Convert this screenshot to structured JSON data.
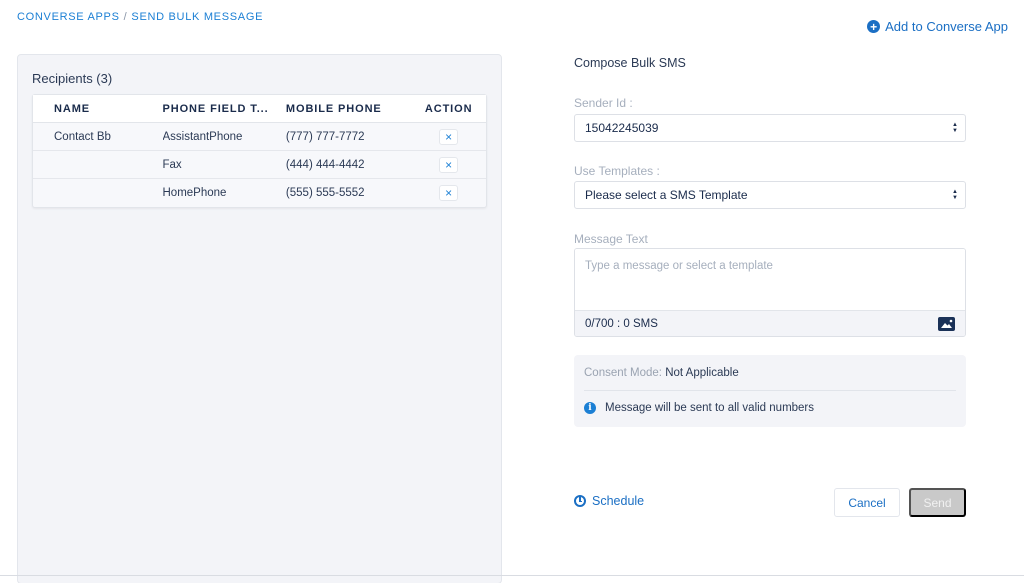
{
  "breadcrumb": {
    "items": [
      "Converse Apps",
      "Send Bulk Message"
    ],
    "separator": "/"
  },
  "header": {
    "add_app_label": "Add to Converse App",
    "add_app_icon": "plus-circle-icon"
  },
  "recipients": {
    "title": "Recipients (3)",
    "columns": [
      "NAME",
      "PHONE FIELD T...",
      "MOBILE PHONE",
      "ACTION"
    ],
    "rows": [
      {
        "name": "Contact Bb",
        "phone_field_type": "AssistantPhone",
        "mobile_phone": "(777) 777-7772",
        "action_icon": "×"
      },
      {
        "name": "",
        "phone_field_type": "Fax",
        "mobile_phone": "(444) 444-4442",
        "action_icon": "×"
      },
      {
        "name": "",
        "phone_field_type": "HomePhone",
        "mobile_phone": "(555) 555-5552",
        "action_icon": "×"
      }
    ]
  },
  "compose": {
    "title": "Compose Bulk SMS",
    "sender_id": {
      "label": "Sender Id :",
      "value": "15042245039"
    },
    "templates": {
      "label": "Use Templates :",
      "value": "Please select a SMS Template"
    },
    "message": {
      "label": "Message Text",
      "value": "",
      "placeholder": "Type a message or select a template",
      "counter": "0/700 : 0 SMS"
    },
    "consent": {
      "key": "Consent Mode:",
      "value": "Not Applicable",
      "info": "Message will be sent to all valid numbers"
    },
    "schedule_label": "Schedule",
    "cancel_label": "Cancel",
    "send_label": "Send"
  },
  "colors": {
    "accent": "#1b7fd4",
    "text_dark": "#16325c",
    "panel_bg": "#f3f4f8",
    "send_disabled": "#c9c9c9"
  }
}
